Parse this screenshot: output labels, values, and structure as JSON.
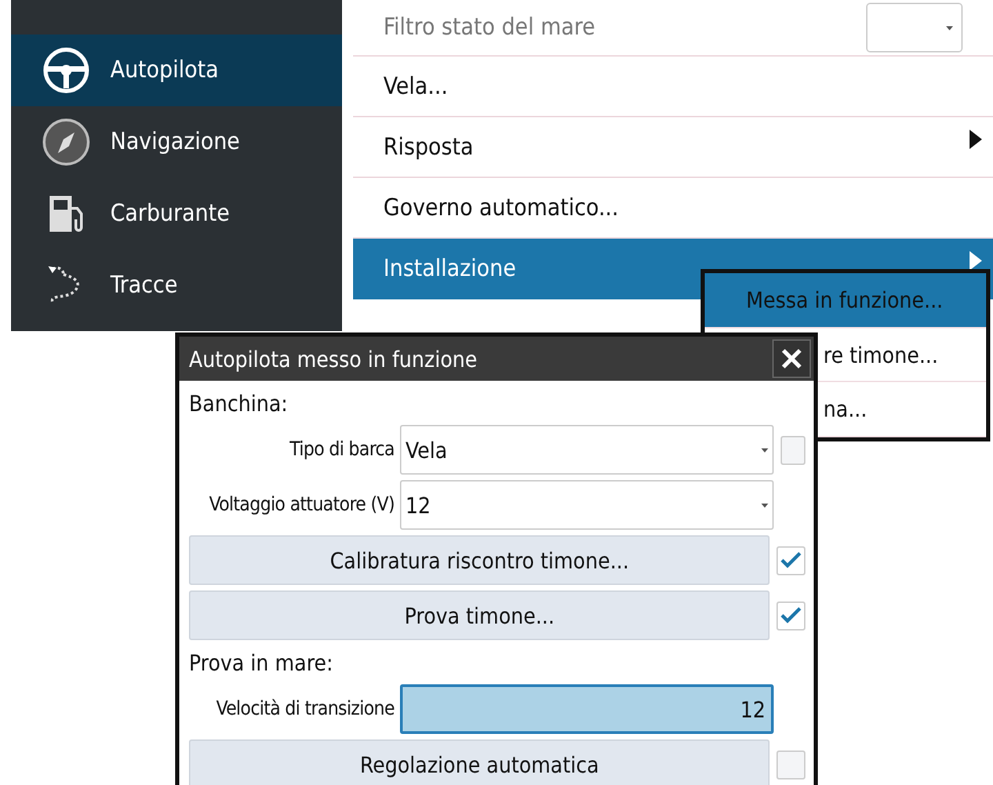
{
  "sidebar": {
    "items": [
      {
        "label": "Autopilota",
        "selected": true
      },
      {
        "label": "Navigazione",
        "selected": false
      },
      {
        "label": "Carburante",
        "selected": false
      },
      {
        "label": "Tracce",
        "selected": false
      }
    ]
  },
  "menu": {
    "items": [
      {
        "label": "Filtro stato del mare",
        "kind": "dropdown",
        "selected": false
      },
      {
        "label": "Vela...",
        "kind": "action",
        "selected": false
      },
      {
        "label": "Risposta",
        "kind": "submenu",
        "selected": false
      },
      {
        "label": "Governo automatico...",
        "kind": "action",
        "selected": false
      },
      {
        "label": "Installazione",
        "kind": "submenu",
        "selected": true
      }
    ]
  },
  "submenu": {
    "items": [
      {
        "label": "Messa in funzione...",
        "selected": true
      },
      {
        "label": "re timone...",
        "selected": false
      },
      {
        "label": "na...",
        "selected": false
      }
    ]
  },
  "dialog": {
    "title": "Autopilota messo in funzione",
    "rows": [
      {
        "kind": "heading",
        "label": "Banchina:"
      },
      {
        "kind": "select",
        "label": "Tipo di barca",
        "value": "Vela",
        "checked": false
      },
      {
        "kind": "select",
        "label": "Voltaggio attuatore (V)",
        "value": "12"
      },
      {
        "kind": "button",
        "label": "Calibratura riscontro timone...",
        "checked": true
      },
      {
        "kind": "button",
        "label": "Prova timone...",
        "checked": true
      },
      {
        "kind": "heading",
        "label": "Prova in mare:"
      },
      {
        "kind": "number",
        "label": "Velocità di transizione",
        "value": "12"
      },
      {
        "kind": "button",
        "label": "Regolazione automatica",
        "checked": false
      }
    ]
  }
}
